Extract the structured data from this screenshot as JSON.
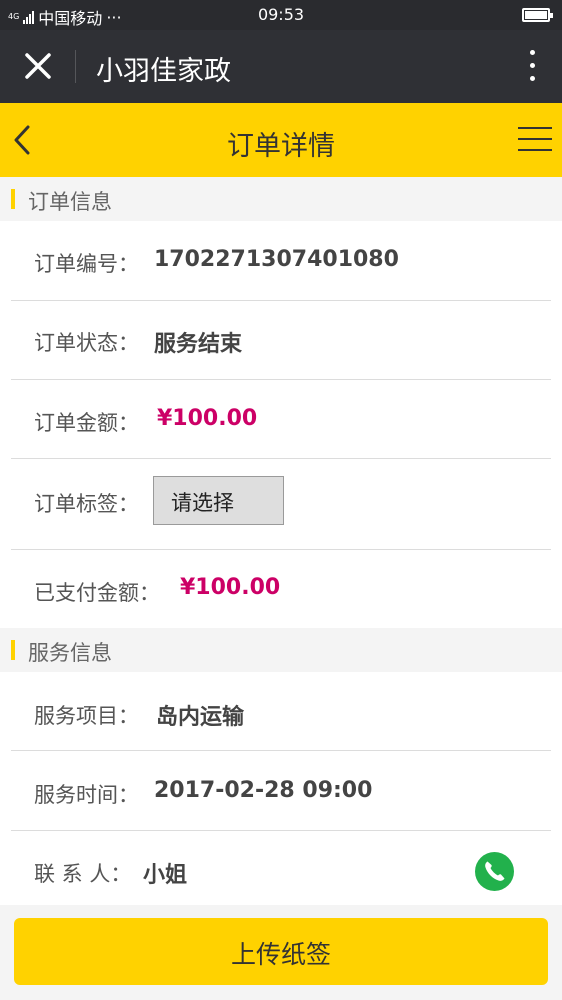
{
  "status_bar": {
    "network": "4G",
    "carrier": "中国移动",
    "dots": "···",
    "time": "09:53"
  },
  "wx": {
    "title": "小羽佳家政"
  },
  "header": {
    "title": "订单详情"
  },
  "order_section": {
    "title": "订单信息",
    "number_label": "订单编号：",
    "number_value": "1702271307401080",
    "status_label": "订单状态：",
    "status_value": "服务结束",
    "amount_label": "订单金额：",
    "amount_value": "¥100.00",
    "tag_label": "订单标签：",
    "tag_select": "请选择",
    "paid_label": "已支付金额：",
    "paid_value": "¥100.00"
  },
  "service_section": {
    "title": "服务信息",
    "item_label": "服务项目：",
    "item_value": "岛内运输",
    "time_label": "服务时间：",
    "time_value": "2017-02-28 09:00",
    "contact_label": "联 系 人：",
    "contact_value": "小姐"
  },
  "actions": {
    "upload": "上传纸签"
  },
  "colors": {
    "accent": "#ffd200",
    "money": "#cc0066",
    "phone": "#22b14c"
  }
}
